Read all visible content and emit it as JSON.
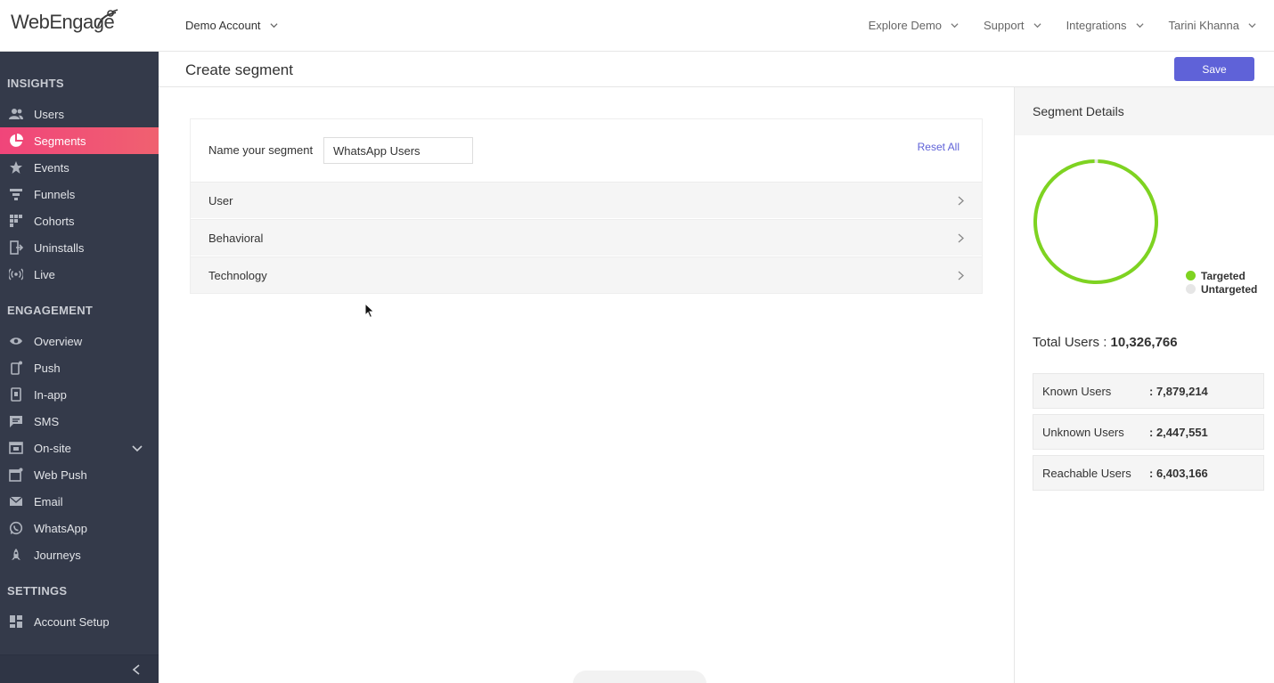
{
  "topbar": {
    "logo_text": "WebEngage",
    "account": "Demo Account",
    "nav": [
      {
        "label": "Explore Demo"
      },
      {
        "label": "Support"
      },
      {
        "label": "Integrations"
      },
      {
        "label": "Tarini Khanna"
      }
    ]
  },
  "sidebar": {
    "sections": {
      "insights": "INSIGHTS",
      "engagement": "ENGAGEMENT",
      "settings": "SETTINGS"
    },
    "insights_items": [
      {
        "label": "Users",
        "icon": "users-icon"
      },
      {
        "label": "Segments",
        "icon": "pie-chart-icon",
        "active": true
      },
      {
        "label": "Events",
        "icon": "star-icon"
      },
      {
        "label": "Funnels",
        "icon": "funnel-icon"
      },
      {
        "label": "Cohorts",
        "icon": "grid-icon"
      },
      {
        "label": "Uninstalls",
        "icon": "exit-icon"
      },
      {
        "label": "Live",
        "icon": "broadcast-icon"
      }
    ],
    "engagement_items": [
      {
        "label": "Overview",
        "icon": "eye-icon"
      },
      {
        "label": "Push",
        "icon": "mobile-icon"
      },
      {
        "label": "In-app",
        "icon": "inapp-icon"
      },
      {
        "label": "SMS",
        "icon": "chat-icon"
      },
      {
        "label": "On-site",
        "icon": "window-icon"
      },
      {
        "label": "Web Push",
        "icon": "browser-notification-icon"
      },
      {
        "label": "Email",
        "icon": "mail-icon"
      },
      {
        "label": "WhatsApp",
        "icon": "whatsapp-icon"
      },
      {
        "label": "Journeys",
        "icon": "rocket-icon"
      }
    ],
    "settings_items": [
      {
        "label": "Account Setup",
        "icon": "dashboard-icon"
      }
    ]
  },
  "page": {
    "title": "Create segment",
    "save_label": "Save"
  },
  "segment": {
    "name_label": "Name your segment",
    "name_value": "WhatsApp Users",
    "reset_label": "Reset All",
    "filters": [
      {
        "label": "User"
      },
      {
        "label": "Behavioral"
      },
      {
        "label": "Technology"
      }
    ]
  },
  "details": {
    "title": "Segment Details",
    "legend": [
      {
        "label": "Targeted",
        "color": "#7ed321"
      },
      {
        "label": "Untargeted",
        "color": "#e6e6e6"
      }
    ],
    "targeted_fraction": 1.0,
    "total_label": "Total Users : ",
    "total_value": "10,326,766",
    "stats": [
      {
        "label": "Known Users",
        "value": ": 7,879,214"
      },
      {
        "label": "Unknown Users",
        "value": ": 2,447,551"
      },
      {
        "label": "Reachable Users",
        "value": ": 6,403,166"
      }
    ]
  },
  "colors": {
    "accent": "#5f62d8",
    "sidebar_bg": "#343a4a",
    "active_gradient_start": "#f0457a",
    "targeted": "#7ed321"
  }
}
